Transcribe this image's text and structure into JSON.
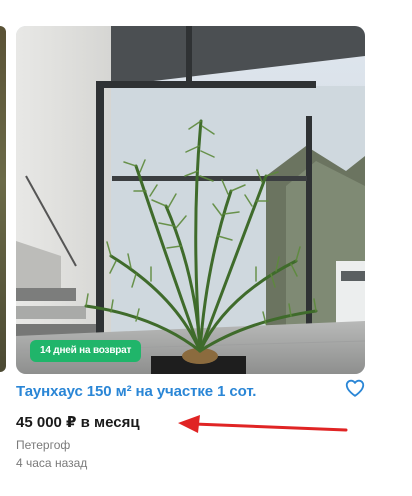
{
  "listing": {
    "badge": "14 дней на возврат",
    "title": "Таунхаус 150 м² на участке 1 сот.",
    "price": "45 000 ₽ в месяц",
    "location": "Петергоф",
    "posted": "4 часа назад",
    "favorite_icon": "heart-outline-icon",
    "title_color": "#2a86d6",
    "badge_color": "#20b56a"
  },
  "annotation": {
    "arrow_color": "#e02424",
    "arrow_target": "price"
  }
}
